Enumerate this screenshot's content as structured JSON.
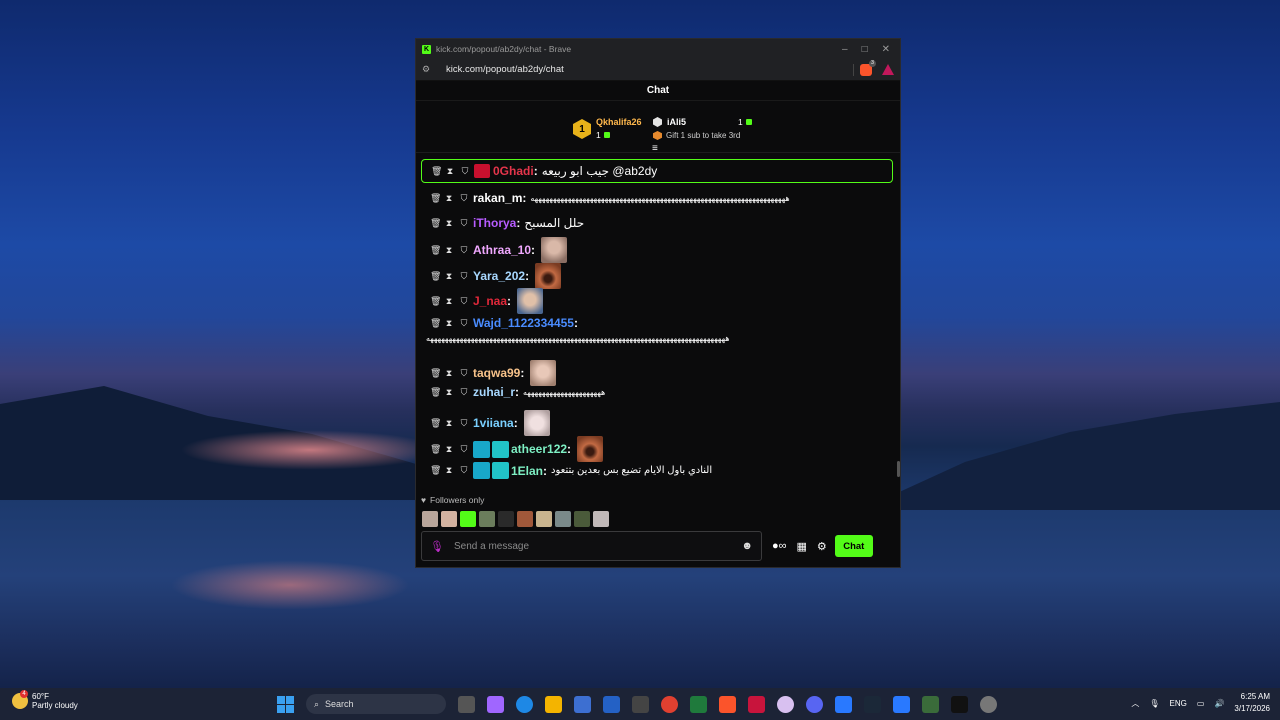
{
  "window": {
    "title": "kick.com/popout/ab2dy/chat - Brave",
    "url": "kick.com/popout/ab2dy/chat",
    "favicon": "K",
    "brave_badge": "3"
  },
  "chat": {
    "header": "Chat",
    "leaderboard": {
      "first_rank": "1",
      "first_name": "Qkhalifa26",
      "first_count": "1",
      "second_name": "iAli5",
      "second_count": "1",
      "gift_text": "Gift 1 sub to take 3rd"
    },
    "messages": [
      {
        "user": "0Ghadi",
        "color": "#e5354b",
        "text": "جيب ابو ربيعه @ab2dy",
        "pinned": true
      },
      {
        "user": "rakan_m",
        "color": "#ffffff",
        "text": "هههههههههههههههههههههههههههههههههههههههههههههههههههههههههههههههههههههه"
      },
      {
        "user": "iThorya",
        "color": "#b75cff",
        "text": "حلل المسبح"
      },
      {
        "user": "Athraa_10",
        "color": "#f0a8ff",
        "text": ""
      },
      {
        "user": "Yara_202",
        "color": "#a8d8ff",
        "text": ""
      },
      {
        "user": "J_naa",
        "color": "#e0283a",
        "text": ""
      },
      {
        "user": "Wajd_1122334455",
        "color": "#4a8cff",
        "text": "",
        "continuation": "هههههههههههههههههههههههههههههههههههههههههههههههههههههههههههههههههههههههههههههههههه"
      },
      {
        "user": "taqwa99",
        "color": "#f7c28a",
        "text": ""
      },
      {
        "user": "zuhai_r",
        "color": "#a8d8ff",
        "text": "هههههههههههههههههههههه"
      },
      {
        "user": "1viiana",
        "color": "#7ad0ff",
        "text": ""
      },
      {
        "user": "atheer122",
        "color": "#7ef0c4",
        "text": ""
      },
      {
        "user": "1Elan",
        "color": "#7ef0c4",
        "text": "النادي باول الايام تضيع بس بعدين بتتعود"
      }
    ],
    "followers_label": "Followers only",
    "input_placeholder": "Send a message",
    "send_label": "Chat"
  },
  "taskbar": {
    "weather_temp": "60°F",
    "weather_desc": "Partly cloudy",
    "weather_badge": "4",
    "search_label": "Search",
    "lang": "ENG",
    "time": "6:25 AM",
    "date": "3/17/2026"
  },
  "colors": {
    "kick_green": "#53fc18",
    "gold": "#e8b21a",
    "panel_bg": "#0b0b0c"
  }
}
